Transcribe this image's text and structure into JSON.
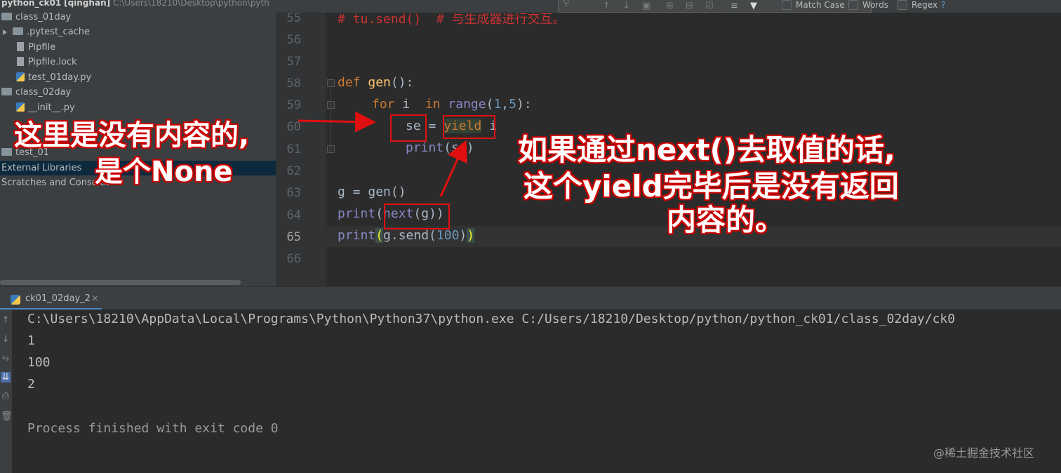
{
  "project": {
    "title_name": "python_ck01",
    "title_user": "[qinghan]",
    "title_path": "C:\\Users\\18210\\Desktop\\python\\pyth",
    "tree": [
      {
        "label": "class_01day",
        "kind": "folder"
      },
      {
        "label": ".pytest_cache",
        "kind": "folder"
      },
      {
        "label": "Pipfile",
        "kind": "file"
      },
      {
        "label": "Pipfile.lock",
        "kind": "file"
      },
      {
        "label": "test_01day.py",
        "kind": "py"
      },
      {
        "label": "class_02day",
        "kind": "folder"
      },
      {
        "label": "__init__.py",
        "kind": "py"
      },
      {
        "label": "test_01",
        "kind": "folder"
      },
      {
        "label": "External Libraries",
        "kind": "lib"
      },
      {
        "label": "Scratches and Consoles",
        "kind": "scratch"
      }
    ]
  },
  "findbar": {
    "match_case": "Match Case",
    "words": "Words",
    "regex": "Regex",
    "help": "?"
  },
  "editor": {
    "line_numbers": [
      "55",
      "56",
      "57",
      "58",
      "59",
      "60",
      "61",
      "62",
      "63",
      "64",
      "65",
      "66"
    ],
    "line55_comment": "# tu.send()  # 与生成器进行交互。",
    "line58": {
      "kw": "def",
      "fn": "gen",
      "rest": "():"
    },
    "line59": {
      "for": "for",
      "var": "i",
      "in": "in",
      "range": "range",
      "open": "(",
      "n1": "1",
      "comma": ",",
      "n2": "5",
      "close": "):"
    },
    "line60": {
      "se": "se",
      "eq": " = ",
      "yield": "yield",
      "i": " i"
    },
    "line61": {
      "print": "print",
      "arg": "(se)"
    },
    "line63": {
      "g": "g",
      "rest": " = gen()"
    },
    "line64": {
      "print": "print",
      "open": "(",
      "next": "next",
      "arg": "(g)",
      "close": ")"
    },
    "line65": {
      "print": "print",
      "open": "(",
      "call": "g.send(",
      "num": "100",
      "close1": ")",
      "close2": ")"
    }
  },
  "run": {
    "tab_label": "ck01_02day_2",
    "tab_close": "×",
    "output": [
      "C:\\Users\\18210\\AppData\\Local\\Programs\\Python\\Python37\\python.exe C:/Users/18210/Desktop/python/python_ck01/class_02day/ck0",
      "1",
      "100",
      "2",
      "",
      "Process finished with exit code 0"
    ]
  },
  "annotations": {
    "left_line1": "这里是没有内容的,",
    "left_line2": "是个None",
    "right_line1": "如果通过next()去取值的话,",
    "right_line2": "这个yield完毕后是没有返回",
    "right_line3": "内容的。"
  },
  "watermark": "@稀土掘金技术社区",
  "colors": {
    "annotation_red": "#e01010",
    "keyword": "#cc7832",
    "function": "#ffc66d",
    "number": "#6897bb"
  }
}
